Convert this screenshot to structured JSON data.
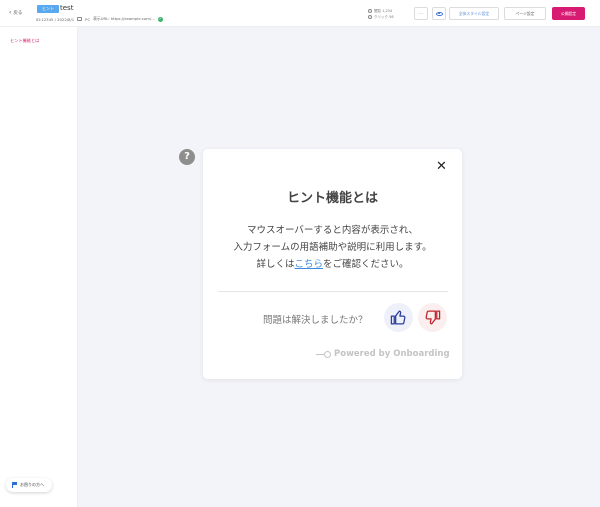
{
  "header": {
    "back_label": "戻る",
    "badge": "ヒント",
    "title": "test",
    "meta_id": "ID:12345 / 2022/8/1",
    "meta_device": "PC",
    "meta_url": "表示URL: https://example.com/...",
    "stats_views": "閲覧 1,234",
    "stats_clicks": "クリック 56",
    "more_label": "···",
    "style_button": "全体スタイル設定",
    "page_button": "ページ設定",
    "publish_button": "公開設定"
  },
  "sidebar": {
    "items": [
      {
        "label": "ヒント機能とは"
      }
    ],
    "help_label": "お困りの方へ"
  },
  "canvas": {
    "marker_symbol": "?",
    "card": {
      "close_symbol": "✕",
      "title": "ヒント機能とは",
      "line1": "マウスオーバーすると内容が表示され、",
      "line2": "入力フォームの用語補助や説明に利用します。",
      "line3_before": "詳しくは",
      "line3_link": "こちら",
      "line3_after": "をご確認ください。",
      "resolved_question": "問題は解決しましたか？",
      "powered_by": "Powered by Onboarding"
    }
  },
  "colors": {
    "accent_pink": "#d81b72",
    "badge_blue": "#5aa9ef",
    "thumb_up": "#2a3d9c",
    "thumb_down": "#c0272d"
  },
  "icons": {
    "back": "chevron-left-icon",
    "eye": "eye-icon",
    "marker": "question-icon",
    "close": "close-icon",
    "thumb_up": "thumb-up-icon",
    "thumb_down": "thumb-down-icon",
    "help_flag": "flag-icon"
  }
}
